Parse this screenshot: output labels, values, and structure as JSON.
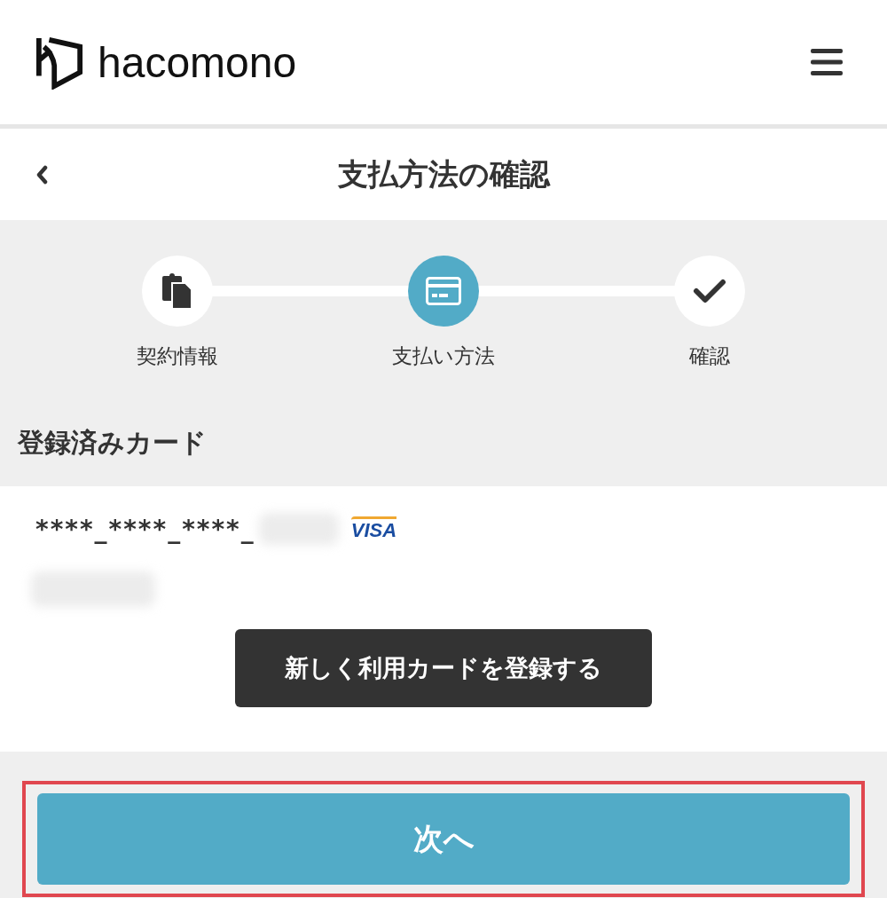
{
  "header": {
    "logo_text": "hacomono"
  },
  "title_bar": {
    "title": "支払方法の確認"
  },
  "steps": [
    {
      "kind": "document",
      "label": "契約情報",
      "selected": false
    },
    {
      "kind": "card",
      "label": "支払い方法",
      "selected": true
    },
    {
      "kind": "check",
      "label": "確認",
      "selected": false
    }
  ],
  "section": {
    "title": "登録済みカード"
  },
  "card": {
    "number_prefix": "****_****_****_",
    "brand": "VISA"
  },
  "register_button": {
    "label": "新しく利用カードを登録する"
  },
  "next_button": {
    "label": "次へ",
    "highlighted": true
  }
}
